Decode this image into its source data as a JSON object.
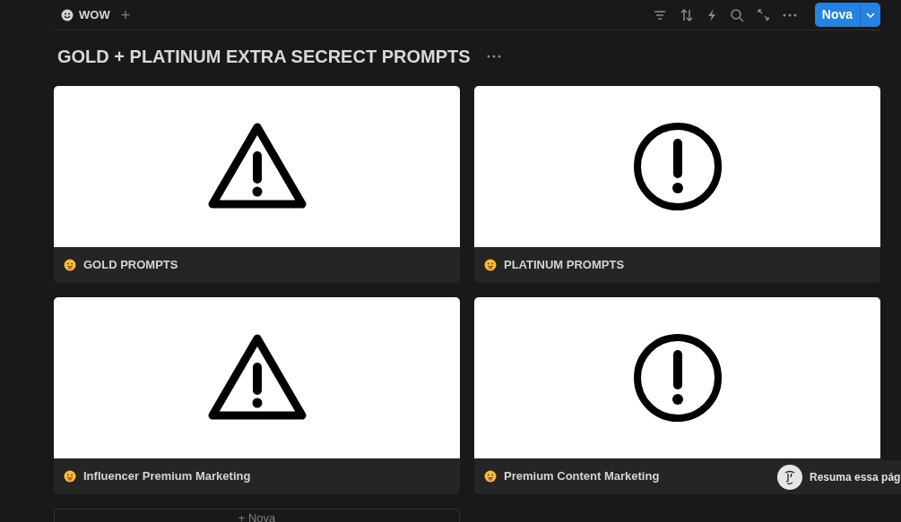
{
  "view_tab": {
    "label": "WOW",
    "add": "+"
  },
  "toolbar": {
    "new_button": "Nova"
  },
  "title": "GOLD + PLATINUM EXTRA SECRECT PROMPTS",
  "cards": [
    {
      "title": "GOLD PROMPTS",
      "kind": "warning"
    },
    {
      "title": "PLATINUM PROMPTS",
      "kind": "alert"
    },
    {
      "title": "Influencer Premium Marketing",
      "kind": "warning"
    },
    {
      "title": "Premium Content Marketing",
      "kind": "alert"
    }
  ],
  "new_card": "+ Nova",
  "assistant_popup": "Resuma essa pág"
}
